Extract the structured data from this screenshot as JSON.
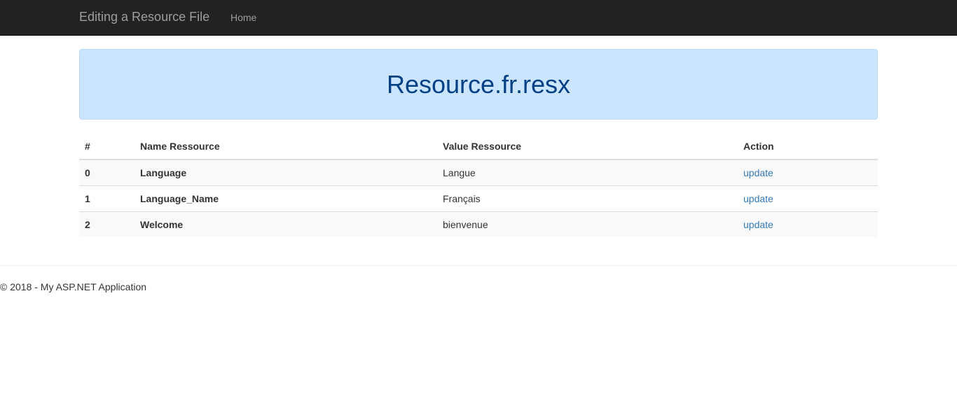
{
  "navbar": {
    "brand": "Editing a Resource File",
    "home": "Home"
  },
  "jumbotron": {
    "title": "Resource.fr.resx"
  },
  "table": {
    "headers": [
      "#",
      "Name Ressource",
      "Value Ressource",
      "Action"
    ],
    "rows": [
      {
        "index": "0",
        "name": "Language",
        "value": "Langue",
        "action": "update"
      },
      {
        "index": "1",
        "name": "Language_Name",
        "value": "Français",
        "action": "update"
      },
      {
        "index": "2",
        "name": "Welcome",
        "value": "bienvenue",
        "action": "update"
      }
    ]
  },
  "footer": {
    "text": "© 2018 - My ASP.NET Application"
  },
  "colors": {
    "navbar": "#222222",
    "jumbotron_bg": "#cce5ff",
    "title": "#004085",
    "link": "#337ab7"
  }
}
